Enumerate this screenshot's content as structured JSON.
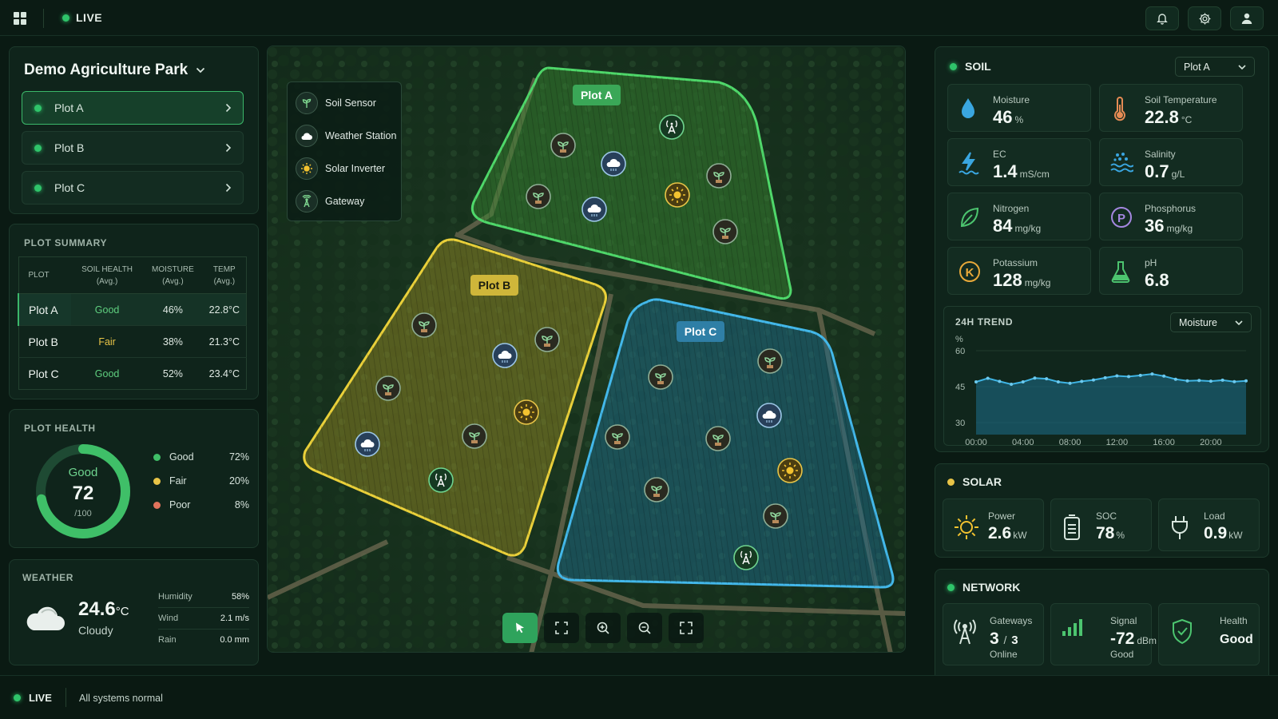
{
  "topbar": {
    "live_label": "LIVE"
  },
  "park": {
    "name": "Demo Agriculture Park",
    "plots": [
      {
        "label": "Plot A",
        "status": "active"
      },
      {
        "label": "Plot B"
      },
      {
        "label": "Plot C"
      }
    ]
  },
  "summary": {
    "title": "PLOT SUMMARY",
    "headers": {
      "plot": "PLOT",
      "soil": "SOIL HEALTH",
      "soil_sub": "(Avg.)",
      "moisture": "MOISTURE",
      "moisture_sub": "(Avg.)",
      "temp": "TEMP",
      "temp_sub": "(Avg.)"
    },
    "rows": [
      {
        "plot": "Plot A",
        "health": "Good",
        "moisture": "46%",
        "temp": "22.8°C"
      },
      {
        "plot": "Plot B",
        "health": "Fair",
        "moisture": "38%",
        "temp": "21.3°C"
      },
      {
        "plot": "Plot C",
        "health": "Good",
        "moisture": "52%",
        "temp": "23.4°C"
      }
    ]
  },
  "health": {
    "title": "PLOT HEALTH",
    "status": "Good",
    "score": "72",
    "score_max": "/100",
    "score_fraction": 0.72,
    "legend": [
      {
        "label": "Good",
        "pct": "72%",
        "color": "#3fbf68"
      },
      {
        "label": "Fair",
        "pct": "20%",
        "color": "#e8c447"
      },
      {
        "label": "Poor",
        "pct": "8%",
        "color": "#e0735c"
      }
    ]
  },
  "weather": {
    "title": "WEATHER",
    "temp": "24.6",
    "temp_unit": "°C",
    "condition": "Cloudy",
    "humidity_label": "Humidity",
    "humidity": "58%",
    "wind_label": "Wind",
    "wind": "2.1 m/s",
    "rain_label": "Rain",
    "rain": "0.0 mm"
  },
  "map": {
    "legend": [
      {
        "label": "Soil Sensor",
        "icon": "sprout-icon"
      },
      {
        "label": "Weather Station",
        "icon": "cloud-icon"
      },
      {
        "label": "Solar Inverter",
        "icon": "sun-icon"
      },
      {
        "label": "Gateway",
        "icon": "antenna-icon"
      }
    ],
    "plot_labels": {
      "a": "Plot A",
      "b": "Plot B",
      "c": "Plot C"
    },
    "colors": {
      "plot_a": "#3ec45a",
      "plot_b": "#e2c12e",
      "plot_c": "#3ea8d8"
    }
  },
  "soil": {
    "title": "SOIL",
    "selected_plot": "Plot A",
    "metrics": [
      {
        "label": "Moisture",
        "value": "46",
        "unit": "%",
        "icon": "droplet-icon"
      },
      {
        "label": "Soil Temperature",
        "value": "22.8",
        "unit": "°C",
        "icon": "thermometer-icon"
      },
      {
        "label": "EC",
        "value": "1.4",
        "unit": "mS/cm",
        "icon": "lightning-icon"
      },
      {
        "label": "Salinity",
        "value": "0.7",
        "unit": "g/L",
        "icon": "salinity-icon"
      },
      {
        "label": "Nitrogen",
        "value": "84",
        "unit": "mg/kg",
        "icon": "leaf-icon"
      },
      {
        "label": "Phosphorus",
        "value": "36",
        "unit": "mg/kg",
        "icon": "phosphorus-icon"
      },
      {
        "label": "Potassium",
        "value": "128",
        "unit": "mg/kg",
        "icon": "potassium-icon"
      },
      {
        "label": "pH",
        "value": "6.8",
        "unit": "",
        "icon": "flask-icon"
      }
    ]
  },
  "trend": {
    "title": "24H TREND",
    "selected_metric": "Moisture",
    "y_unit": "%",
    "y_ticks": [
      "60",
      "45",
      "30"
    ],
    "x_ticks": [
      "00:00",
      "04:00",
      "08:00",
      "12:00",
      "16:00",
      "20:00"
    ]
  },
  "chart_data": {
    "type": "area",
    "title": "24H TREND",
    "xlabel": "",
    "ylabel": "%",
    "ylim": [
      25,
      65
    ],
    "x": [
      "00:00",
      "01:00",
      "02:00",
      "03:00",
      "04:00",
      "05:00",
      "06:00",
      "07:00",
      "08:00",
      "09:00",
      "10:00",
      "11:00",
      "12:00",
      "13:00",
      "14:00",
      "15:00",
      "16:00",
      "17:00",
      "18:00",
      "19:00",
      "20:00",
      "21:00",
      "22:00",
      "23:00"
    ],
    "series": [
      {
        "values": [
          47.0,
          48.5,
          47.2,
          46.0,
          47.0,
          48.6,
          48.3,
          47.0,
          46.4,
          47.2,
          47.8,
          48.7,
          49.5,
          49.2,
          49.7,
          50.3,
          49.4,
          48.1,
          47.4,
          47.6,
          47.3,
          47.7,
          47.1,
          47.4
        ]
      }
    ]
  },
  "solar": {
    "title": "SOLAR",
    "power_label": "Power",
    "power": "2.6",
    "power_unit": "kW",
    "soc_label": "SOC",
    "soc": "78",
    "soc_unit": "%",
    "load_label": "Load",
    "load": "0.9",
    "load_unit": "kW"
  },
  "network": {
    "title": "NETWORK",
    "gateways_label": "Gateways",
    "gateways_online": "3",
    "gateways_sep": "/",
    "gateways_total": "3",
    "gateways_status": "Online",
    "signal_label": "Signal",
    "signal": "-72",
    "signal_unit": "dBm",
    "signal_status": "Good",
    "health_label": "Health",
    "health": "Good"
  },
  "status": {
    "live_label": "LIVE",
    "message": "All systems normal"
  }
}
